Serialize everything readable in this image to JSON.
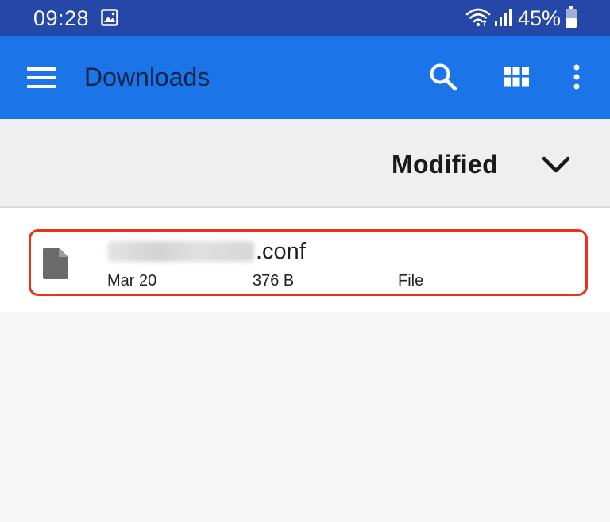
{
  "status_bar": {
    "time": "09:28",
    "battery": "45%",
    "icons": [
      "gallery-icon",
      "wifi-icon",
      "signal-icon",
      "battery-icon"
    ]
  },
  "app_bar": {
    "title": "Downloads",
    "actions": [
      "menu-icon",
      "search-icon",
      "grid-view-icon",
      "more-options-icon"
    ],
    "color": "#1c74e9"
  },
  "sort_bar": {
    "label": "Modified"
  },
  "files": [
    {
      "name_ext": ".conf",
      "date": "Mar 20",
      "size": "376 B",
      "type": "File",
      "icon": "file-icon"
    }
  ],
  "colors": {
    "status_bar": "#2447a8",
    "app_bar": "#1c74e9",
    "highlight": "#e8321c",
    "background": "#f6f6f6"
  }
}
